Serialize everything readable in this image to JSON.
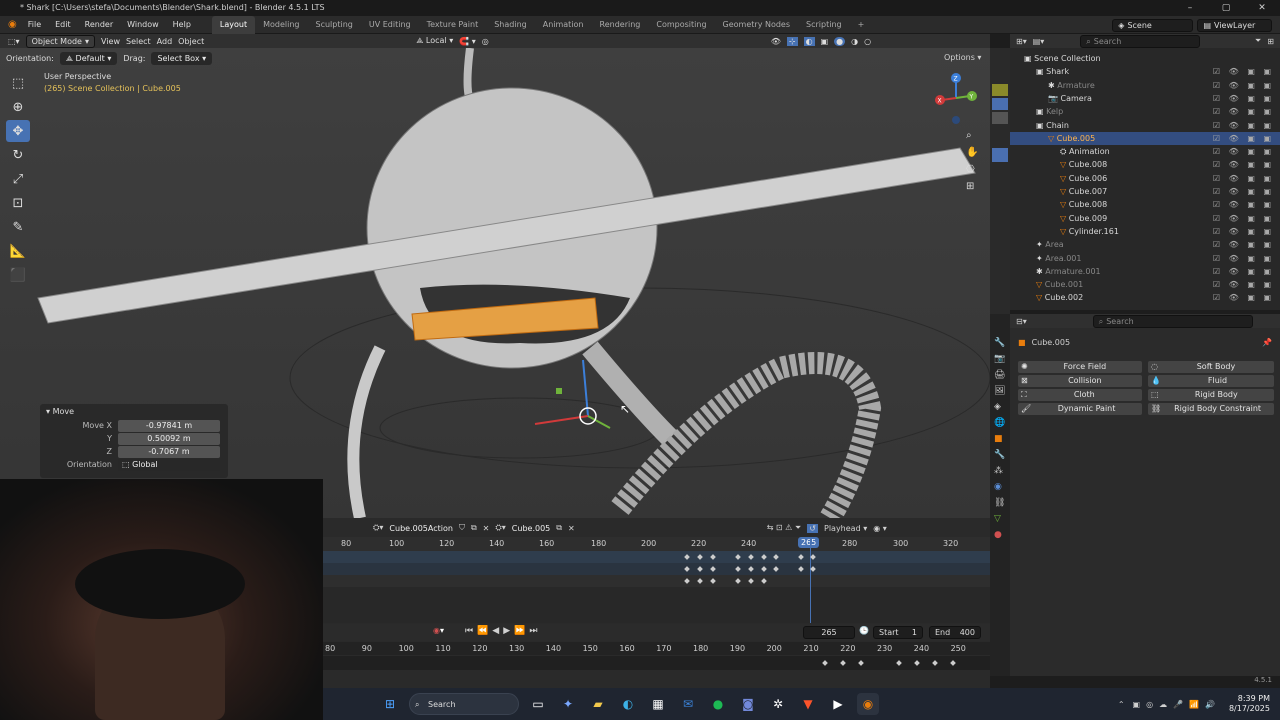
{
  "window": {
    "title": "* Shark [C:\\Users\\stefa\\Documents\\Blender\\Shark.blend] - Blender 4.5.1 LTS"
  },
  "menu": [
    "File",
    "Edit",
    "Render",
    "Window",
    "Help"
  ],
  "workspaces": [
    "Layout",
    "Modeling",
    "Sculpting",
    "UV Editing",
    "Texture Paint",
    "Shading",
    "Animation",
    "Rendering",
    "Compositing",
    "Geometry Nodes",
    "Scripting"
  ],
  "scene": {
    "name": "Scene",
    "view_layer": "ViewLayer"
  },
  "viewport": {
    "mode": "Object Mode",
    "menus": [
      "View",
      "Select",
      "Add",
      "Object"
    ],
    "transform_space": "Local",
    "orientation_label": "Orientation:",
    "orientation": "Default",
    "drag_label": "Drag:",
    "drag": "Select Box",
    "options": "Options",
    "view_name": "User Perspective",
    "view_info": "(265) Scene Collection | Cube.005",
    "gizmo_axes": [
      "X",
      "Y",
      "Z"
    ]
  },
  "move_panel": {
    "title": "Move",
    "x_label": "Move X",
    "x_value": "-0.97841 m",
    "y_label": "Y",
    "y_value": "0.50092 m",
    "z_label": "Z",
    "z_value": "-0.7067 m",
    "orientation_label": "Orientation",
    "orientation_value": "Global"
  },
  "dopesheet": {
    "action": "Cube.005Action",
    "object": "Cube.005",
    "snap": "Playhead",
    "ticks": [
      "80",
      "100",
      "120",
      "140",
      "160",
      "180",
      "200",
      "220",
      "240",
      "265",
      "280",
      "300",
      "320"
    ],
    "current_frame": "265"
  },
  "playback": {
    "frame": "265",
    "start_label": "Start",
    "start": "1",
    "end_label": "End",
    "end": "400"
  },
  "ruler2": [
    "80",
    "90",
    "100",
    "110",
    "120",
    "130",
    "140",
    "150",
    "160",
    "170",
    "180",
    "190",
    "200",
    "210",
    "220",
    "230",
    "240",
    "250"
  ],
  "outliner": {
    "search_placeholder": "Search",
    "rows": [
      {
        "label": "Scene Collection",
        "indent": 0
      },
      {
        "label": "Shark",
        "indent": 1
      },
      {
        "label": "Armature",
        "indent": 2,
        "dim": true
      },
      {
        "label": "Camera",
        "indent": 2
      },
      {
        "label": "Kelp",
        "indent": 1,
        "dim": true
      },
      {
        "label": "Chain",
        "indent": 1
      },
      {
        "label": "Cube.005",
        "indent": 2,
        "sel": true
      },
      {
        "label": "Animation",
        "indent": 3
      },
      {
        "label": "Cube.008",
        "indent": 3
      },
      {
        "label": "Cube.006",
        "indent": 3
      },
      {
        "label": "Cube.007",
        "indent": 3
      },
      {
        "label": "Cube.008",
        "indent": 3
      },
      {
        "label": "Cube.009",
        "indent": 3
      },
      {
        "label": "Cylinder.161",
        "indent": 3
      },
      {
        "label": "Area",
        "indent": 1,
        "dim": true
      },
      {
        "label": "Area.001",
        "indent": 1,
        "dim": true
      },
      {
        "label": "Armature.001",
        "indent": 1,
        "dim": true
      },
      {
        "label": "Cube.001",
        "indent": 1,
        "dim": true
      },
      {
        "label": "Cube.002",
        "indent": 1
      }
    ]
  },
  "properties": {
    "search_placeholder": "Search",
    "object": "Cube.005",
    "physics": [
      "Force Field",
      "Soft Body",
      "Collision",
      "Fluid",
      "Cloth",
      "Rigid Body",
      "Dynamic Paint",
      "Rigid Body Constraint"
    ]
  },
  "status": {
    "version": "4.5.1"
  },
  "taskbar": {
    "search": "Search",
    "time": "8:39 PM",
    "date": "8/17/2025"
  }
}
